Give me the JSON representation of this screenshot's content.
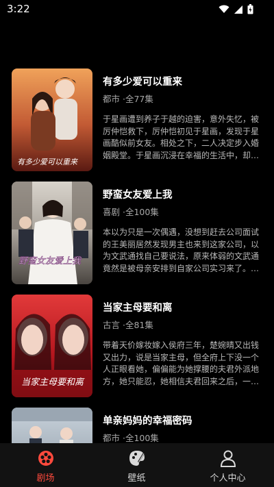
{
  "status_bar": {
    "time": "3:22"
  },
  "dramas": [
    {
      "title": "有多少爱可以重来",
      "meta": "都市 ·全77集",
      "description": "于星画遭到养子于越的迫害，意外失忆，被厉仲恺救下，厉仲恺初见于星画，发现于星画酷似前女友。相处之下，二人决定步入婚姻殿堂。于星画沉浸在幸福的生活中，却不知危机将近。于越为了承继家…",
      "cover_text": "有多少爱可以重来"
    },
    {
      "title": "野蛮女友爱上我",
      "meta": "喜剧 ·全100集",
      "description": "本以为只是一次偶遇，没想到赶去公司面试的王美丽居然发现男主也来到这家公司，以为文武通找自己要说法，原来体弱的文武通竟然是被母亲安排到自家公司实习来了。面试时野蛮的王美丽和文武通…",
      "cover_text": "野蛮女友爱上我"
    },
    {
      "title": "当家主母要和离",
      "meta": "古言 ·全81集",
      "description": "带着天价嫁妆嫁入侯府三年，楚婉晴又出钱又出力，说是当家主母，但全府上下没一个人正眼看她，偏偏能为她撑腰的夫君外派地方，她只能忍，她相信夫君回来之后，一切都会变好。然而现实给了她一…",
      "cover_text": "当家主母要和离"
    },
    {
      "title": "单亲妈妈的幸福密码",
      "meta": "都市 ·全100集",
      "description": "",
      "cover_text": ""
    }
  ],
  "tabbar": {
    "tabs": [
      {
        "label": "剧场",
        "icon": "film-reel-icon",
        "active": true
      },
      {
        "label": "壁纸",
        "icon": "paint-palette-icon",
        "active": false
      },
      {
        "label": "个人中心",
        "icon": "user-icon",
        "active": false
      }
    ]
  },
  "colors": {
    "accent": "#ff4a3d",
    "background": "#000000",
    "tabbar": "#121212"
  }
}
